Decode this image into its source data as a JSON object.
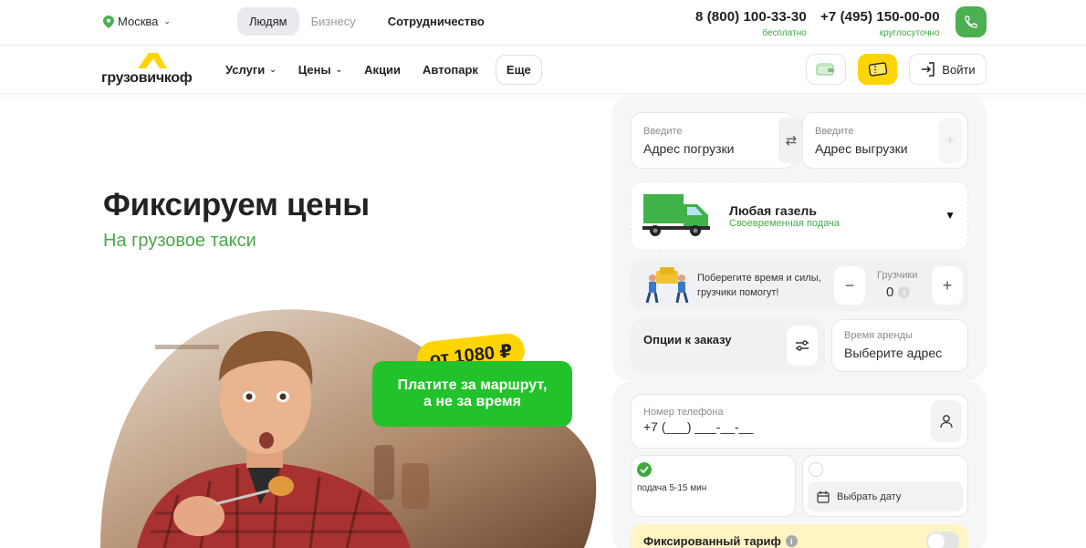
{
  "topbar": {
    "city": "Москва",
    "tabs": [
      {
        "label": "Людям",
        "active": true
      },
      {
        "label": "Бизнесу",
        "active": false
      },
      {
        "label": "Сотрудничество",
        "active": false
      }
    ],
    "phones": [
      {
        "number": "8 (800) 100-33-30",
        "note": "бесплатно"
      },
      {
        "number": "+7 (495) 150-00-00",
        "note": "круглосуточно"
      }
    ],
    "call_icon": "phone-icon"
  },
  "nav": {
    "logo_text": "грузовичкоф",
    "items": [
      {
        "label": "Услуги",
        "has_dropdown": true
      },
      {
        "label": "Цены",
        "has_dropdown": true
      },
      {
        "label": "Акции",
        "has_dropdown": false
      },
      {
        "label": "Автопарк",
        "has_dropdown": false
      }
    ],
    "more_label": "Еще",
    "login_label": "Войти"
  },
  "hero": {
    "title": "Фиксируем цены",
    "subtitle": "На грузовое такси",
    "price_badge": "от 1080 ₽",
    "promo_line1": "Платите за маршрут,",
    "promo_line2": "а не за время"
  },
  "form": {
    "from_label": "Введите",
    "from_value": "Адрес погрузки",
    "to_label": "Введите",
    "to_value": "Адрес выгрузки",
    "truck_name": "Любая газель",
    "truck_note": "Своевременная подача",
    "movers_text": "Поберегите время и силы, грузчики помогут!",
    "movers_label": "Грузчики",
    "movers_count": "0",
    "options_label": "Опции к заказу",
    "rent_label": "Время аренды",
    "rent_value": "Выберите адрес",
    "phone_label": "Номер телефона",
    "phone_value": "+7 (___) ___-__-__",
    "when_now": "подача 5-15 мин",
    "date_label": "Выбрать дату",
    "fixed_label": "Фиксированный тариф",
    "fixed_enabled": false
  },
  "colors": {
    "brand_green": "#4aa84a",
    "call_green": "#4caf50",
    "promo_green": "#22c22a",
    "brand_yellow": "#ffd400",
    "fixed_bg": "#fff4c4"
  }
}
